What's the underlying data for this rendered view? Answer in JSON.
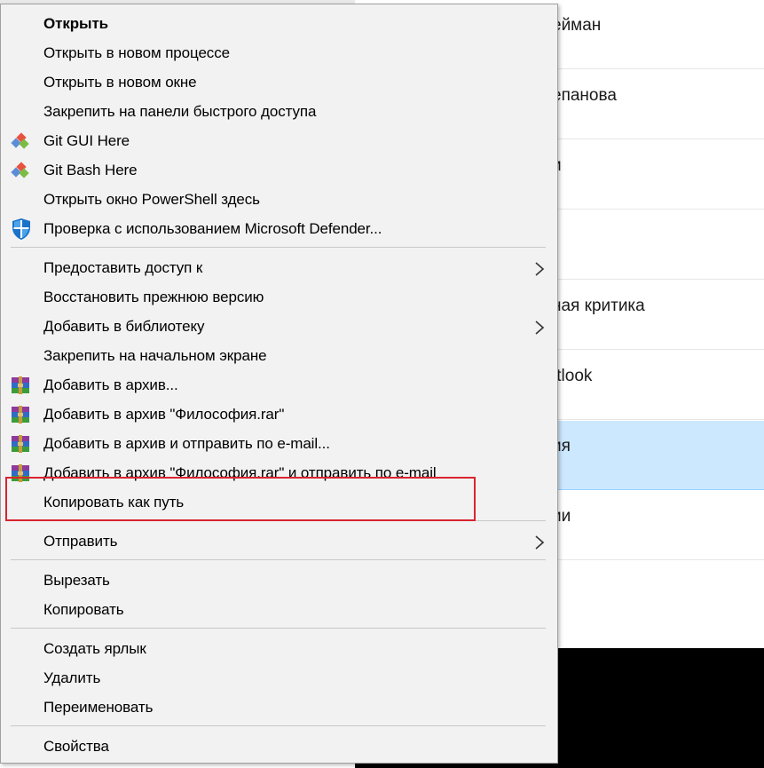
{
  "menu": {
    "items": [
      {
        "label": "Открыть",
        "bold": true
      },
      {
        "label": "Открыть в новом процессе"
      },
      {
        "label": "Открыть в новом окне"
      },
      {
        "label": "Закрепить на панели быстрого доступа"
      },
      {
        "label": "Git GUI Here",
        "icon": "git-gui-icon"
      },
      {
        "label": "Git Bash Here",
        "icon": "git-bash-icon"
      },
      {
        "label": "Открыть окно PowerShell здесь"
      },
      {
        "label": "Проверка с использованием Microsoft Defender...",
        "icon": "defender-shield-icon"
      },
      {
        "label": "Предоставить доступ к",
        "submenu": true
      },
      {
        "label": "Восстановить прежнюю версию"
      },
      {
        "label": "Добавить в библиотеку",
        "submenu": true
      },
      {
        "label": "Закрепить на начальном экране"
      },
      {
        "label": "Добавить в архив...",
        "icon": "winrar-icon"
      },
      {
        "label": "Добавить в архив \"Философия.rar\"",
        "icon": "winrar-icon"
      },
      {
        "label": "Добавить в архив и отправить по e-mail...",
        "icon": "winrar-icon"
      },
      {
        "label": "Добавить в архив \"Философия.rar\" и отправить по e-mail",
        "icon": "winrar-icon"
      },
      {
        "label": "Копировать как путь",
        "highlighted": true
      },
      {
        "label": "Отправить",
        "submenu": true
      },
      {
        "label": "Вырезать"
      },
      {
        "label": "Копировать"
      },
      {
        "label": "Создать ярлык"
      },
      {
        "label": "Удалить"
      },
      {
        "label": "Переименовать"
      },
      {
        "label": "Свойства"
      }
    ]
  },
  "background_list": {
    "rows": [
      {
        "text": "ейман"
      },
      {
        "text": "епанова"
      },
      {
        "text": "и"
      },
      {
        "text": ""
      },
      {
        "text": "ная критика"
      },
      {
        "text": "ıtlook"
      },
      {
        "text": "ия",
        "selected": true
      },
      {
        "text": "ии"
      },
      {
        "text": ""
      }
    ]
  },
  "colors": {
    "menu_background": "#f2f2f2",
    "selected_row": "#cce8ff",
    "highlight_border": "#d9252f"
  }
}
